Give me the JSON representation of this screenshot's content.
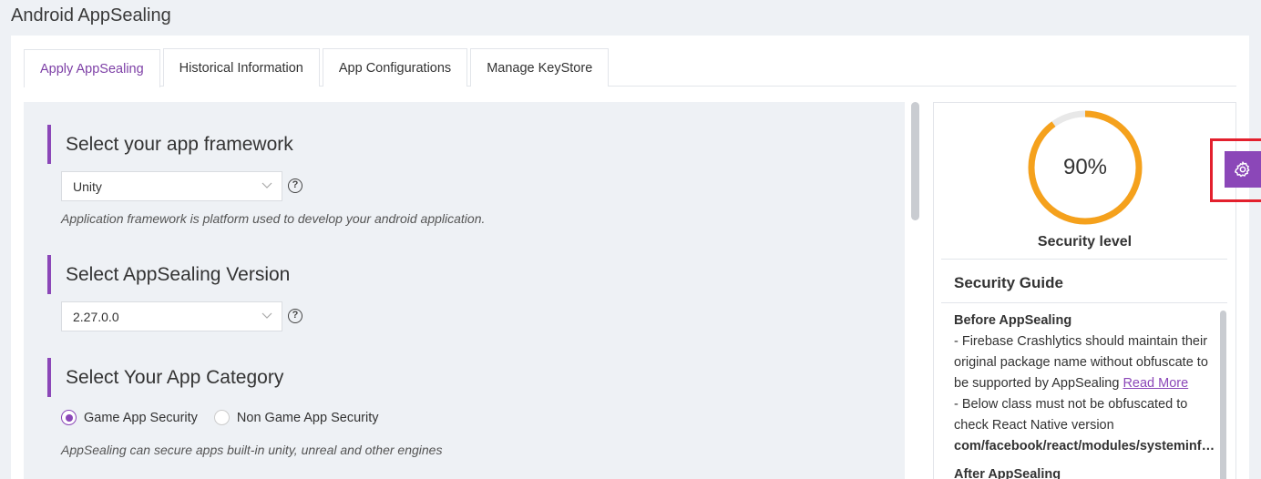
{
  "page": {
    "title": "Android AppSealing"
  },
  "tabs": [
    {
      "label": "Apply AppSealing",
      "active": true
    },
    {
      "label": "Historical Information",
      "active": false
    },
    {
      "label": "App Configurations",
      "active": false
    },
    {
      "label": "Manage KeyStore",
      "active": false
    }
  ],
  "framework": {
    "title": "Select your app framework",
    "value": "Unity",
    "hint": "Application framework is platform used to develop your android application."
  },
  "version": {
    "title": "Select AppSealing Version",
    "value": "2.27.0.0"
  },
  "category": {
    "title": "Select Your App Category",
    "options": [
      {
        "label": "Game App Security",
        "checked": true
      },
      {
        "label": "Non Game App Security",
        "checked": false
      }
    ],
    "hint": "AppSealing can secure apps built-in unity, unreal and other engines"
  },
  "security": {
    "percent_label": "90%",
    "level": 0.9,
    "level_label": "Security level",
    "gauge_color": "#f5a11c",
    "gauge_track_color": "#e8e8e8"
  },
  "guide": {
    "title": "Security Guide",
    "before_heading": "Before AppSealing",
    "line1": "- Firebase Crashlytics should maintain their original package name without obfuscate to be supported by AppSealing",
    "read_more": "Read More",
    "line2": "- Below class must not be obfuscated to check React Native version",
    "code": "com/facebook/react/modules/systeminfo/ReactNativeVersion",
    "after_heading": "After AppSealing"
  },
  "colors": {
    "accent": "#8b47b8",
    "highlight": "#e3202d"
  },
  "icons": {
    "help": "question-circle-icon",
    "gear": "gear-icon",
    "chevron": "chevron-down-icon"
  }
}
